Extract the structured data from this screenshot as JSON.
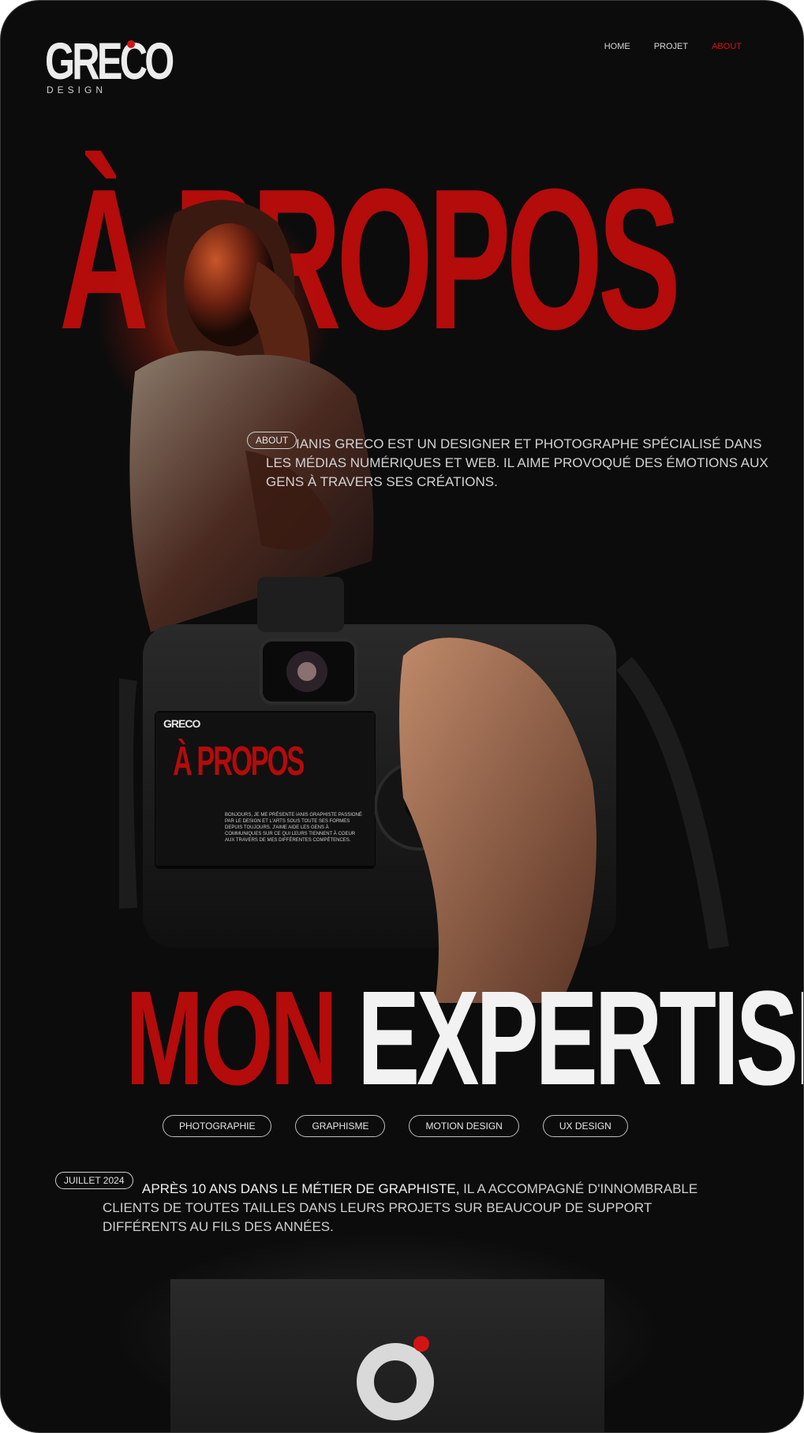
{
  "brand": {
    "logo": "GRECO",
    "logo_sub": "DESIGN",
    "accent": "#d11414"
  },
  "nav": {
    "items": [
      "HOME",
      "PROJET",
      "ABOUT"
    ],
    "active": "ABOUT"
  },
  "hero": {
    "title": "À PROPOS",
    "about_pill": "ABOUT",
    "text": "IANIS GRECO EST UN DESIGNER ET PHOTOGRAPHE SPÉCIALISÉ DANS LES MÉDIAS NUMÉRIQUES ET WEB. IL AIME PROVOQUÉ DES ÉMOTIONS AUX GENS À TRAVERS SES CRÉATIONS."
  },
  "camera_screen": {
    "logo": "GRECO",
    "title": "À PROPOS",
    "text": "BONJOURS, JE ME PRÉSENTE IANIS GRAPHISTE PASSIONÉ PAR LE DESIGN ET L'ARTS SOUS TOUTE SES FORMES DEPUIS TOUJOURS. J'AIME AIDE LES GENS À COMMUNIQUES SUR CE QUI LEURS TIENNENT À COEUR AUX TRAVERS DE MES DIFFÉRENTES COMPÉTENCES."
  },
  "expertise": {
    "title_red": "MON",
    "title_white": "EXPERTISE",
    "tags": [
      "PHOTOGRAPHIE",
      "GRAPHISME",
      "MOTION DESIGN",
      "UX DESIGN"
    ],
    "date": "JUILLET 2024",
    "text_lead": "APRÈS 10 ANS DANS LE MÉTIER DE GRAPHISTE,",
    "text_rest": " IL A ACCOMPAGNÉ D'INNOMBRABLE CLIENTS DE TOUTES TAILLES DANS LEURS PROJETS SUR BEAUCOUP DE SUPPORT DIFFÉRENTS AU FILS DES ANNÉES."
  }
}
